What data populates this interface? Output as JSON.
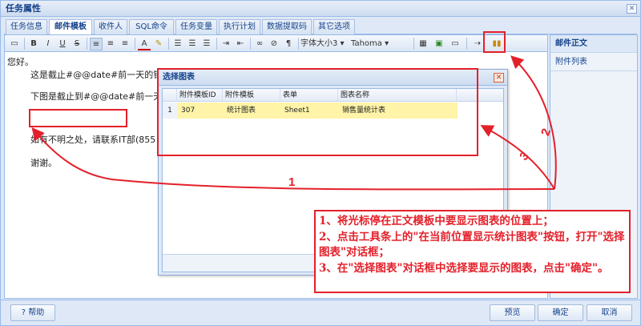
{
  "window": {
    "title": "任务属性",
    "close_glyph": "✕"
  },
  "tabs": [
    "任务信息",
    "邮件模板",
    "收件人",
    "SQL命令",
    "任务变量",
    "执行计划",
    "数据提取码",
    "其它选项"
  ],
  "toolbar": {
    "bold": "B",
    "italic": "I",
    "underline": "U",
    "strike": "S",
    "font_color": "A",
    "font_size": "字体大小3 ▾",
    "font_name": "Tahoma ▾"
  },
  "editor": {
    "lines": [
      "您好。",
      "这是截止#@@date#前一天的销",
      "下图是截止到#@@date#前一天",
      "如有不明之处，请联系IT部(855",
      "谢谢。"
    ]
  },
  "side": {
    "items": [
      "邮件正文",
      "附件列表"
    ]
  },
  "dialog": {
    "title": "选择图表",
    "close_glyph": "✕",
    "columns": [
      "附件模板ID",
      "附件模板",
      "表单",
      "图表名称"
    ],
    "rows": [
      {
        "num": "1",
        "id": "307",
        "template": "统计图表",
        "sheet": "Sheet1",
        "chart": "销售量统计表"
      }
    ]
  },
  "buttons": {
    "help": "帮助",
    "preview": "预览",
    "ok": "确定",
    "cancel": "取消"
  },
  "annotation": {
    "line1": "1、将光标停在正文模板中要显示图表的位置上；",
    "line2": "2、点击工具条上的\"在当前位置显示统计图表\"按钮，打开\"选择图表\"对话框；",
    "line3": "3、在\"选择图表\"对话框中选择要显示的图表，点击\"确定\"。"
  },
  "arrows": {
    "label1": "1",
    "label2": "2",
    "label3": "3"
  },
  "colors": {
    "accent": "#15428b",
    "border": "#99bbe8",
    "highlight_row": "#fff4a8",
    "annotation": "#e3202a"
  }
}
